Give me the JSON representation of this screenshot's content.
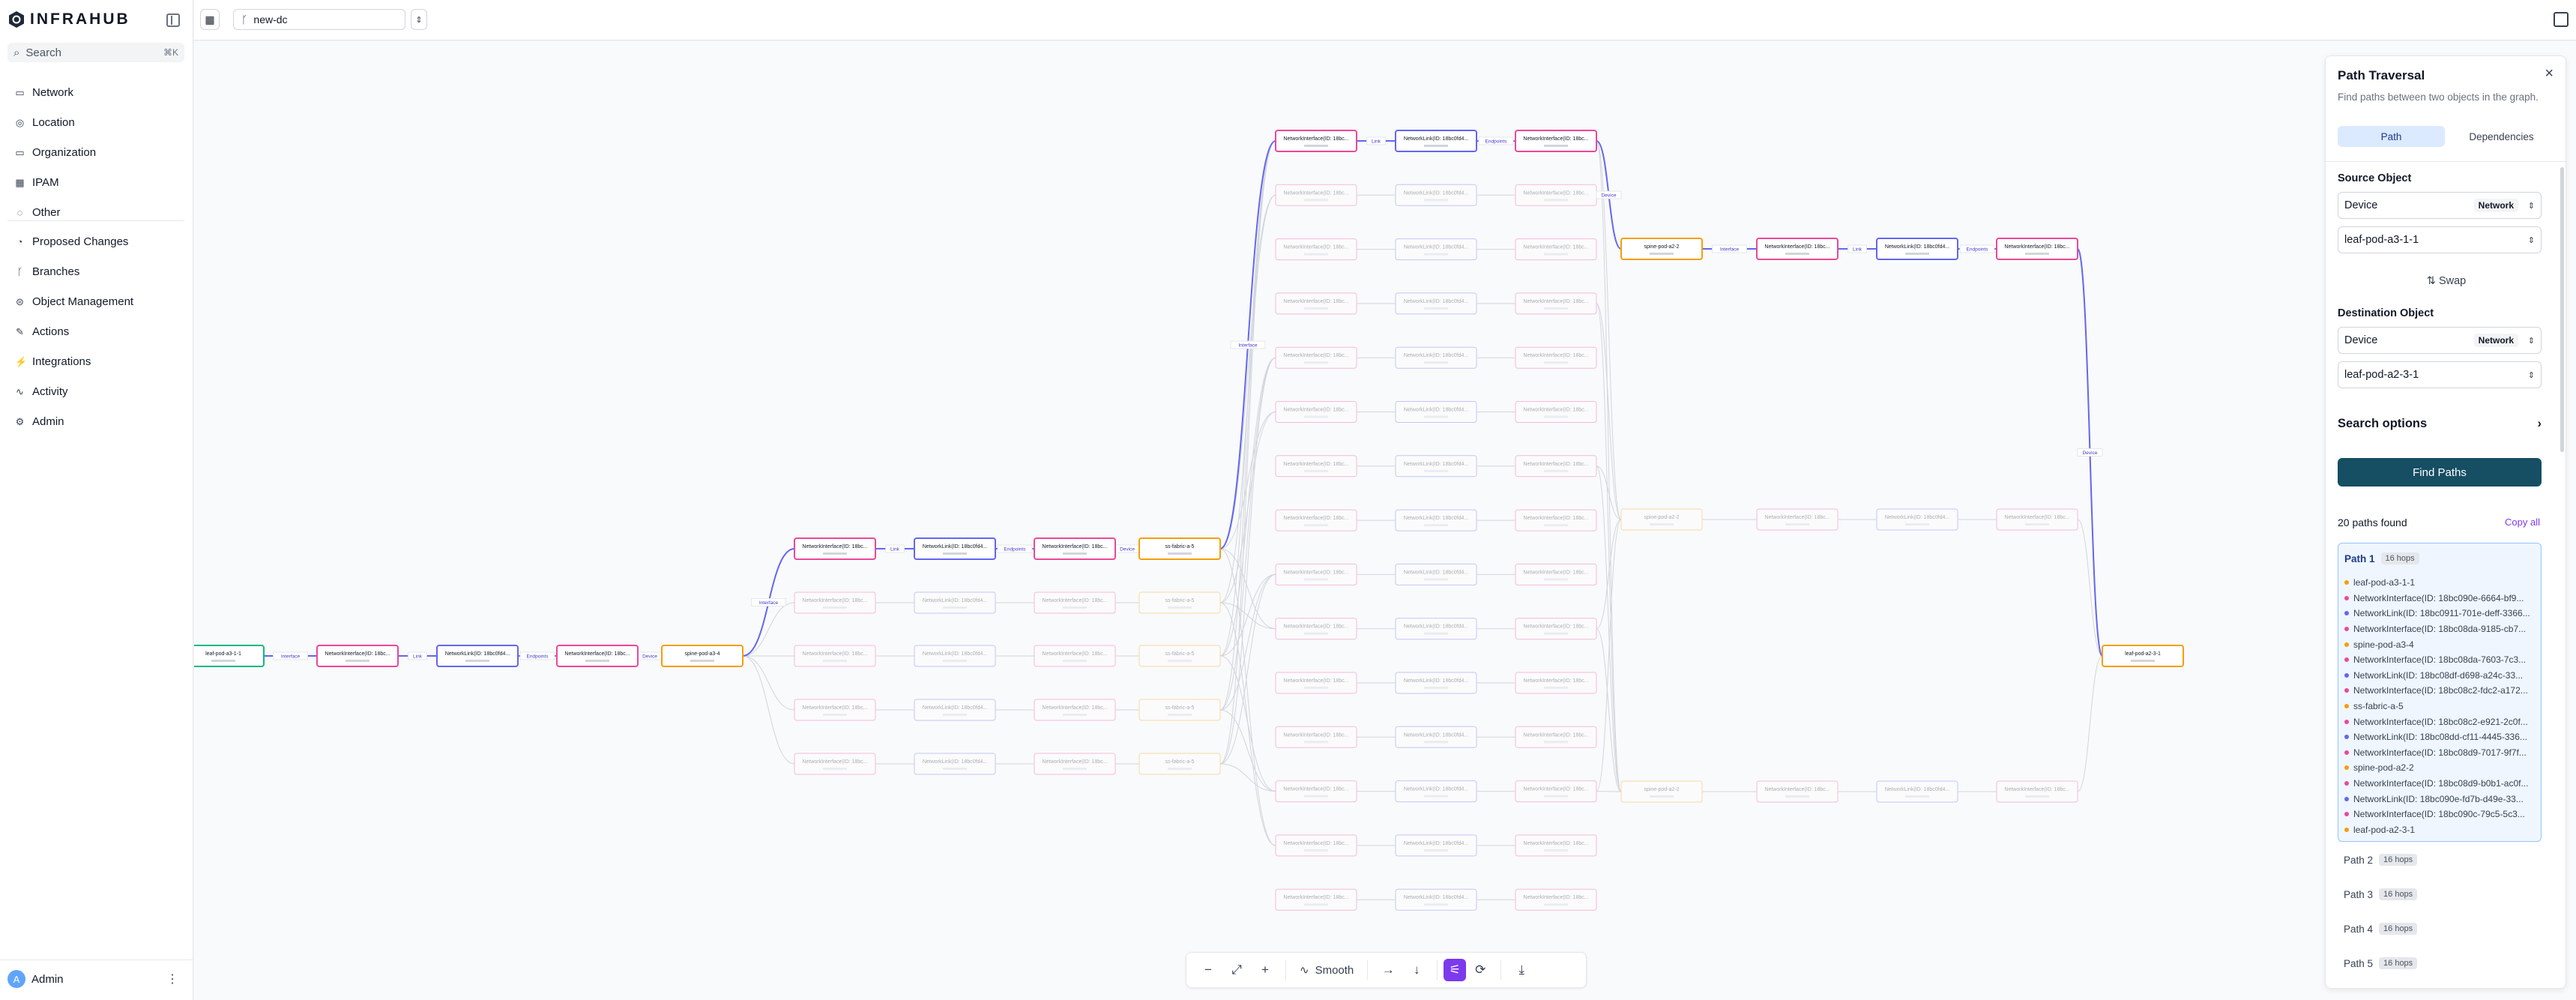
{
  "app": {
    "brand": "INFRAHUB",
    "search_placeholder": "Search",
    "search_shortcut": "⌘K"
  },
  "sidebar": {
    "groups": [
      [
        {
          "label": "Network",
          "icon": "folder-icon"
        },
        {
          "label": "Location",
          "icon": "location-icon"
        },
        {
          "label": "Organization",
          "icon": "folder-icon"
        },
        {
          "label": "IPAM",
          "icon": "ipam-icon"
        },
        {
          "label": "Other",
          "icon": "other-icon"
        }
      ],
      [
        {
          "label": "Proposed Changes",
          "icon": "proposed-changes-icon"
        },
        {
          "label": "Branches",
          "icon": "branches-icon"
        },
        {
          "label": "Object Management",
          "icon": "object-management-icon"
        },
        {
          "label": "Actions",
          "icon": "actions-icon"
        },
        {
          "label": "Integrations",
          "icon": "integrations-icon"
        },
        {
          "label": "Activity",
          "icon": "activity-icon"
        },
        {
          "label": "Admin",
          "icon": "gear-icon"
        }
      ]
    ],
    "user": {
      "name": "Admin",
      "initial": "A"
    }
  },
  "topbar": {
    "branch": "new-dc"
  },
  "graph": {
    "highlight_color": "#6366f1",
    "node_labels": {
      "source": "leaf-pod-a3-1-1",
      "destination": "leaf-pod-a2-3-1",
      "interface": "NetworkInterface(ID: 18bc...",
      "link": "NetworkLink(ID: 18bc0fd4...",
      "spine_a3": "spine-pod-a3-4",
      "spine_a2": "spine-pod-a2-2",
      "superspine": "ss-fabric-a-5"
    },
    "edge_labels": {
      "interface": "Interface",
      "link": "Link",
      "endpoints": "Endpoints",
      "device": "Device"
    }
  },
  "toolbar": {
    "zoom_out": "−",
    "fit": "⤢",
    "zoom_in": "+",
    "smooth_label": "Smooth",
    "dir_right": "→",
    "dir_down": "↓",
    "filter": "⚟",
    "refresh": "⟳",
    "download": "⤓"
  },
  "panel": {
    "title": "Path Traversal",
    "subtitle": "Find paths between two objects in the graph.",
    "tabs": [
      "Path",
      "Dependencies"
    ],
    "source_label": "Source Object",
    "source_kind": "Device",
    "source_kind_badge": "Network",
    "source_value": "leaf-pod-a3-1-1",
    "swap": "⇅ Swap",
    "dest_label": "Destination Object",
    "dest_kind": "Device",
    "dest_kind_badge": "Network",
    "dest_value": "leaf-pod-a2-3-1",
    "search_options": "Search options",
    "find_button": "Find Paths",
    "found": "20 paths found",
    "copy_all": "Copy all",
    "path1": {
      "name": "Path 1",
      "hops": "16 hops",
      "steps": [
        {
          "t": "leaf-pod-a3-1-1",
          "c": "#f59e0b"
        },
        {
          "t": "NetworkInterface(ID: 18bc090e-6664-bf9...",
          "c": "#ec4899"
        },
        {
          "t": "NetworkLink(ID: 18bc0911-701e-deff-3366...",
          "c": "#6366f1"
        },
        {
          "t": "NetworkInterface(ID: 18bc08da-9185-cb7...",
          "c": "#ec4899"
        },
        {
          "t": "spine-pod-a3-4",
          "c": "#f59e0b"
        },
        {
          "t": "NetworkInterface(ID: 18bc08da-7603-7c3...",
          "c": "#ec4899"
        },
        {
          "t": "NetworkLink(ID: 18bc08df-d698-a24c-33...",
          "c": "#6366f1"
        },
        {
          "t": "NetworkInterface(ID: 18bc08c2-fdc2-a172...",
          "c": "#ec4899"
        },
        {
          "t": "ss-fabric-a-5",
          "c": "#f59e0b"
        },
        {
          "t": "NetworkInterface(ID: 18bc08c2-e921-2c0f...",
          "c": "#ec4899"
        },
        {
          "t": "NetworkLink(ID: 18bc08dd-cf11-4445-336...",
          "c": "#6366f1"
        },
        {
          "t": "NetworkInterface(ID: 18bc08d9-7017-9f7f...",
          "c": "#ec4899"
        },
        {
          "t": "spine-pod-a2-2",
          "c": "#f59e0b"
        },
        {
          "t": "NetworkInterface(ID: 18bc08d9-b0b1-ac0f...",
          "c": "#ec4899"
        },
        {
          "t": "NetworkLink(ID: 18bc090e-fd7b-d49e-33...",
          "c": "#6366f1"
        },
        {
          "t": "NetworkInterface(ID: 18bc090c-79c5-5c3...",
          "c": "#ec4899"
        },
        {
          "t": "leaf-pod-a2-3-1",
          "c": "#f59e0b"
        }
      ]
    },
    "other_paths": [
      {
        "name": "Path 2",
        "hops": "16 hops"
      },
      {
        "name": "Path 3",
        "hops": "16 hops"
      },
      {
        "name": "Path 4",
        "hops": "16 hops"
      },
      {
        "name": "Path 5",
        "hops": "16 hops"
      }
    ]
  }
}
